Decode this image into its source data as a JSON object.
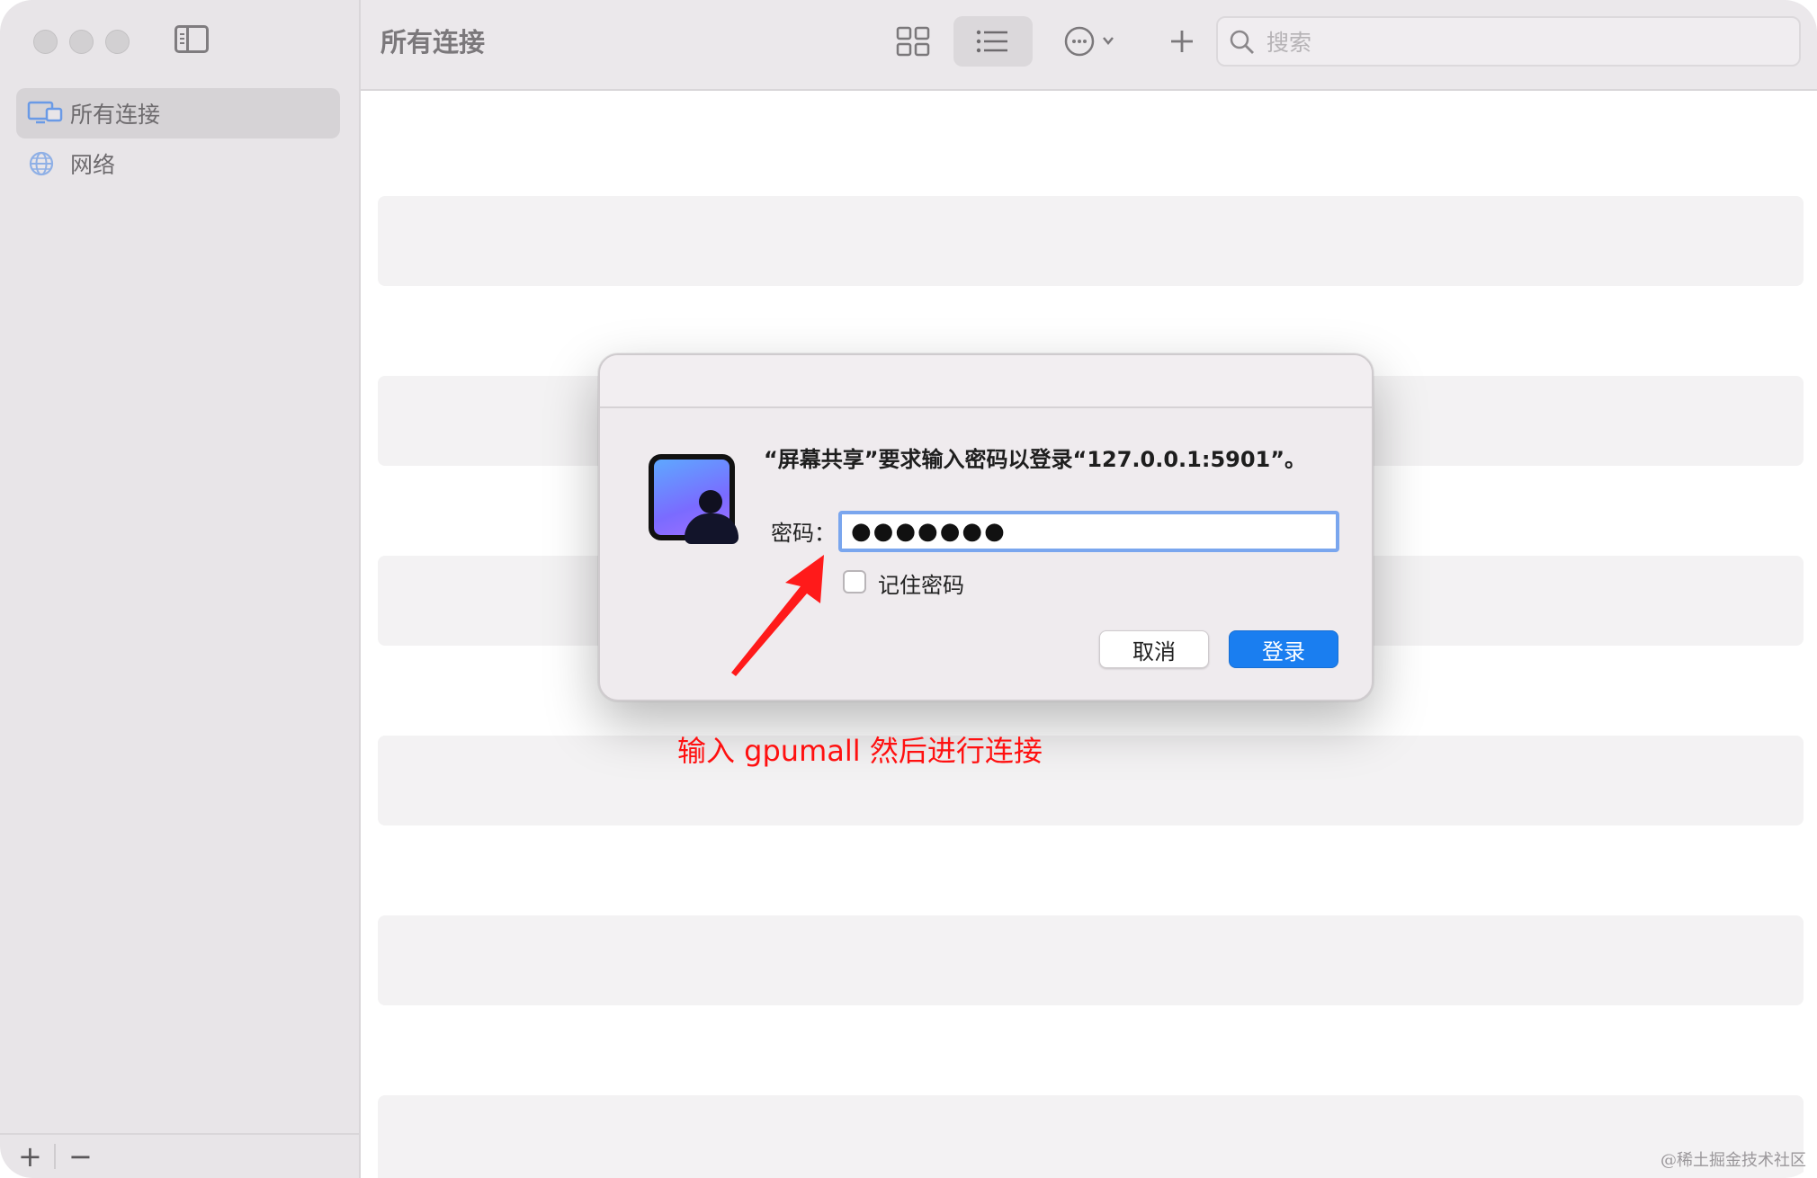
{
  "window": {
    "title": "所有连接"
  },
  "sidebar": {
    "items": [
      {
        "label": "所有连接",
        "icon": "display-icon"
      },
      {
        "label": "网络",
        "icon": "globe-icon"
      }
    ],
    "add_label": "+",
    "remove_label": "−"
  },
  "toolbar": {
    "search_placeholder": "搜索"
  },
  "dialog": {
    "prompt": "“屏幕共享”要求输入密码以登录“127.0.0.1:5901”。",
    "password_label": "密码：",
    "password_value": "●●●●●●●",
    "remember_label": "记住密码",
    "remember_checked": false,
    "cancel_label": "取消",
    "login_label": "登录"
  },
  "annotation": {
    "text": "输入 gpumall 然后进行连接",
    "color": "#ff1010"
  },
  "watermark": "@稀土掘金技术社区",
  "colors": {
    "accent": "#1a7ef0",
    "focus_ring": "#7aa6ee",
    "sidebar_bg": "#e8e5e8"
  }
}
